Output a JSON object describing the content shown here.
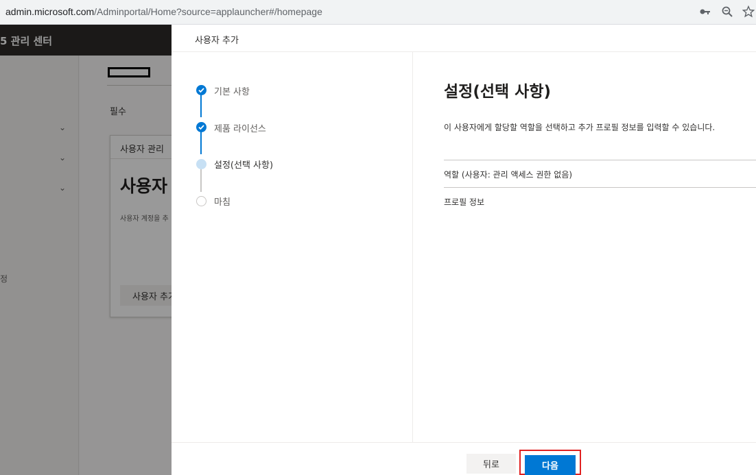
{
  "browser": {
    "url_host": "admin.microsoft.com",
    "url_path": "/Adminportal/Home?source=applauncher#/homepage",
    "icons": [
      "key-icon",
      "zoom-icon",
      "star-icon"
    ]
  },
  "background": {
    "app_title": "5 관리 센터",
    "nav_fragment": "정",
    "required_label": "필수",
    "card": {
      "header": "사용자 관리",
      "big_title": "사용자",
      "description": "사용자 계정을 추",
      "button": "사용자 추가"
    }
  },
  "panel": {
    "title": "사용자 추가",
    "steps": [
      {
        "label": "기본 사항",
        "state": "done"
      },
      {
        "label": "제품 라이선스",
        "state": "done"
      },
      {
        "label": "설정(선택 사항)",
        "state": "current"
      },
      {
        "label": "마침",
        "state": "todo"
      }
    ],
    "content": {
      "title": "설정(선택 사항)",
      "description": "이 사용자에게 할당할 역할을 선택하고 추가 프로필 정보를 입력할 수 있습니다.",
      "sections": [
        "역할 (사용자: 관리 액세스 권한 없음)",
        "프로필 정보"
      ]
    },
    "footer": {
      "back_label": "뒤로",
      "next_label": "다음"
    }
  },
  "colors": {
    "accent": "#0078d4",
    "highlight": "#e02020"
  }
}
